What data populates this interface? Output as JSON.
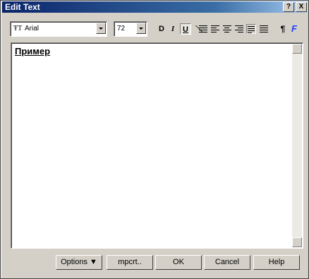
{
  "window": {
    "title": "Edit Text",
    "help_label": "?",
    "close_label": "X"
  },
  "toolbar": {
    "font_icon": "ŦT",
    "font_value": "Arial",
    "size_value": "72",
    "bold_label": "D",
    "italic_label": "I",
    "underline_label": "U",
    "paragraph_label": "¶",
    "font_color_label": "F",
    "accent_color": "#1a3cff"
  },
  "editor": {
    "text": "Пример"
  },
  "buttons": {
    "options": "Options ▼",
    "import": "mpcrt..",
    "ok": "OK",
    "cancel": "Cancel",
    "help": "Help"
  }
}
